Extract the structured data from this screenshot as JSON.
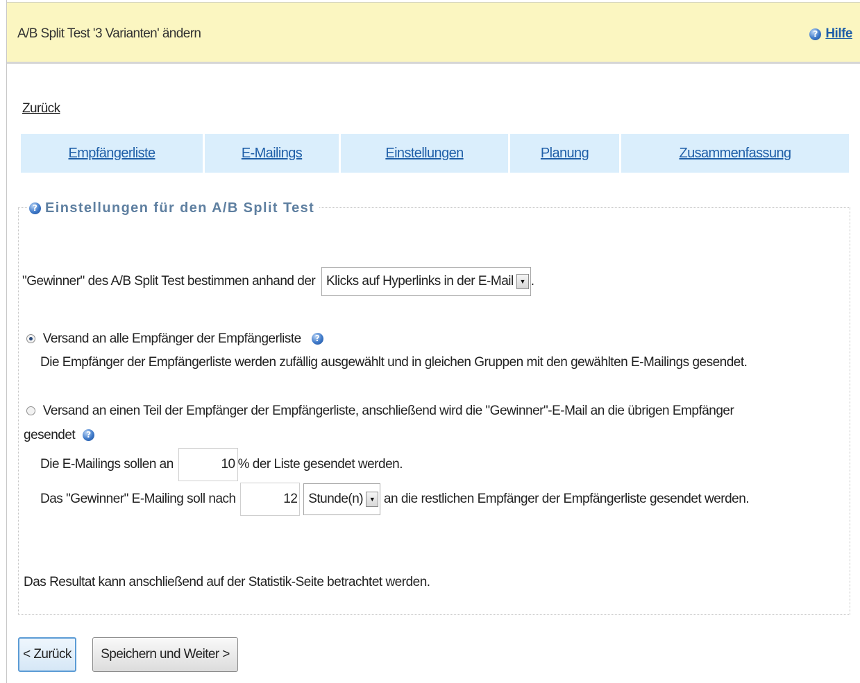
{
  "header": {
    "title": "A/B Split Test '3 Varianten' ändern",
    "help_label": "Hilfe"
  },
  "nav": {
    "back_link": "Zurück"
  },
  "tabs": [
    {
      "label": "Empfängerliste"
    },
    {
      "label": "E-Mailings"
    },
    {
      "label": "Einstellungen"
    },
    {
      "label": "Planung"
    },
    {
      "label": "Zusammenfassung"
    }
  ],
  "settings": {
    "legend": "Einstellungen für den A/B Split Test",
    "winner_prefix": "\"Gewinner\" des A/B Split Test bestimmen anhand der",
    "winner_select_value": "Klicks auf Hyperlinks in der E-Mail",
    "winner_suffix": ".",
    "option_all": {
      "label": "Versand an alle Empfänger der Empfängerliste",
      "description": "Die Empfänger der Empfängerliste werden zufällig ausgewählt und in gleichen Gruppen mit den gewählten E-Mailings gesendet.",
      "selected": true
    },
    "option_partial": {
      "label_line1": "Versand an einen Teil der Empfänger der Empfängerliste, anschließend wird die \"Gewinner\"-E-Mail an die übrigen Empfänger",
      "label_line2": "gesendet",
      "selected": false
    },
    "percent_prefix": "Die E-Mailings sollen an",
    "percent_value": "10",
    "percent_suffix": "% der Liste gesendet werden.",
    "delay_prefix": "Das \"Gewinner\" E-Mailing soll nach",
    "delay_value": "12",
    "delay_unit": "Stunde(n)",
    "delay_suffix": "an die restlichen Empfänger der Empfängerliste gesendet werden.",
    "result_note": "Das Resultat kann anschließend auf der Statistik-Seite betrachtet werden."
  },
  "buttons": {
    "back": "< Zurück",
    "save_next": "Speichern und Weiter >"
  },
  "icons": {
    "help": "question-circle-icon",
    "dropdown": "chevron-down-icon"
  },
  "colors": {
    "header_bg": "#fbf6c1",
    "tab_bg": "#daeefc",
    "link": "#1f5fa8",
    "legend": "#5e7fa0"
  }
}
